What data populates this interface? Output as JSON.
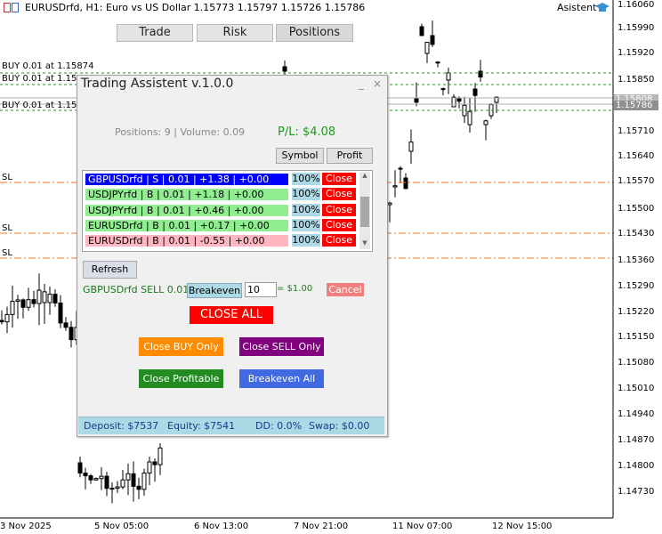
{
  "chart": {
    "title": "EURUSDrfd, H1:  Euro vs US Dollar  1.15773 1.15797 1.15726 1.15786",
    "assistant_label": "Asistent",
    "price_axis": [
      "1.16060",
      "1.15990",
      "1.15920",
      "1.15850",
      "1.15710",
      "1.15640",
      "1.15570",
      "1.15500",
      "1.15430",
      "1.15360",
      "1.15290",
      "1.15220",
      "1.15150",
      "1.15080",
      "1.15010",
      "1.14940",
      "1.14870",
      "1.14800",
      "1.14730"
    ],
    "price_tags": [
      "1.15808",
      "1.15786"
    ],
    "time_axis": [
      "3 Nov 2025",
      "5 Nov 05:00",
      "6 Nov 13:00",
      "7 Nov 21:00",
      "11 Nov 07:00",
      "12 Nov 15:00"
    ],
    "line_labels": [
      "BUY 0.01 at 1.15874",
      "BUY 0.01 at 1.15",
      "BUY 0.01 at 1.15",
      "SL",
      "SL",
      "SL"
    ]
  },
  "panel": {
    "title": "Trading Assistent v.1.0.0",
    "minimize": "_",
    "close": "×",
    "tabs": [
      {
        "label": "Trade"
      },
      {
        "label": "Risk"
      },
      {
        "label": "Positions"
      }
    ],
    "positions_info": "Positions: 9 | Volume: 0.09",
    "pl": "P/L: $4.08",
    "sort_symbol": "Symbol",
    "sort_profit": "Profit",
    "positions": [
      {
        "text": "GBPUSDrfd | S | 0.01 | +1.38 | +0.00",
        "pct": "100%",
        "close": "Close",
        "bg": "#0000ff",
        "fg": "#ffffff"
      },
      {
        "text": "USDJPYrfd | B | 0.01 | +1.18 | +0.00",
        "pct": "100%",
        "close": "Close",
        "bg": "#90ee90",
        "fg": "#000000"
      },
      {
        "text": "USDJPYrfd | B | 0.01 | +0.46 | +0.00",
        "pct": "100%",
        "close": "Close",
        "bg": "#90ee90",
        "fg": "#000000"
      },
      {
        "text": "EURUSDrfd | B | 0.01 | +0.17 | +0.00",
        "pct": "100%",
        "close": "Close",
        "bg": "#90ee90",
        "fg": "#000000"
      },
      {
        "text": "EURUSDrfd | B | 0.01 | -0.55 | +0.00",
        "pct": "100%",
        "close": "Close",
        "bg": "#ffb6c1",
        "fg": "#000000"
      }
    ],
    "refresh": "Refresh",
    "selected": "GBPUSDrfd SELL 0.01",
    "breakeven": "Breakeven",
    "breakeven_value": "10",
    "breakeven_amount": "= $1.00",
    "cancel": "Cancel",
    "close_all": "CLOSE ALL",
    "close_buy": "Close BUY Only",
    "close_sell": "Close SELL Only",
    "close_profitable": "Close Profitable",
    "breakeven_all": "Breakeven All",
    "footer": {
      "deposit": "Deposit: $7537",
      "equity": "Equity: $7541",
      "dd": "DD: 0.0%",
      "swap": "Swap: $0.00"
    }
  },
  "colors": {
    "buy_line": "#2e8b2e",
    "sl_line": "#ff6a2a",
    "bull": "#ffffff",
    "bear": "#000000"
  }
}
